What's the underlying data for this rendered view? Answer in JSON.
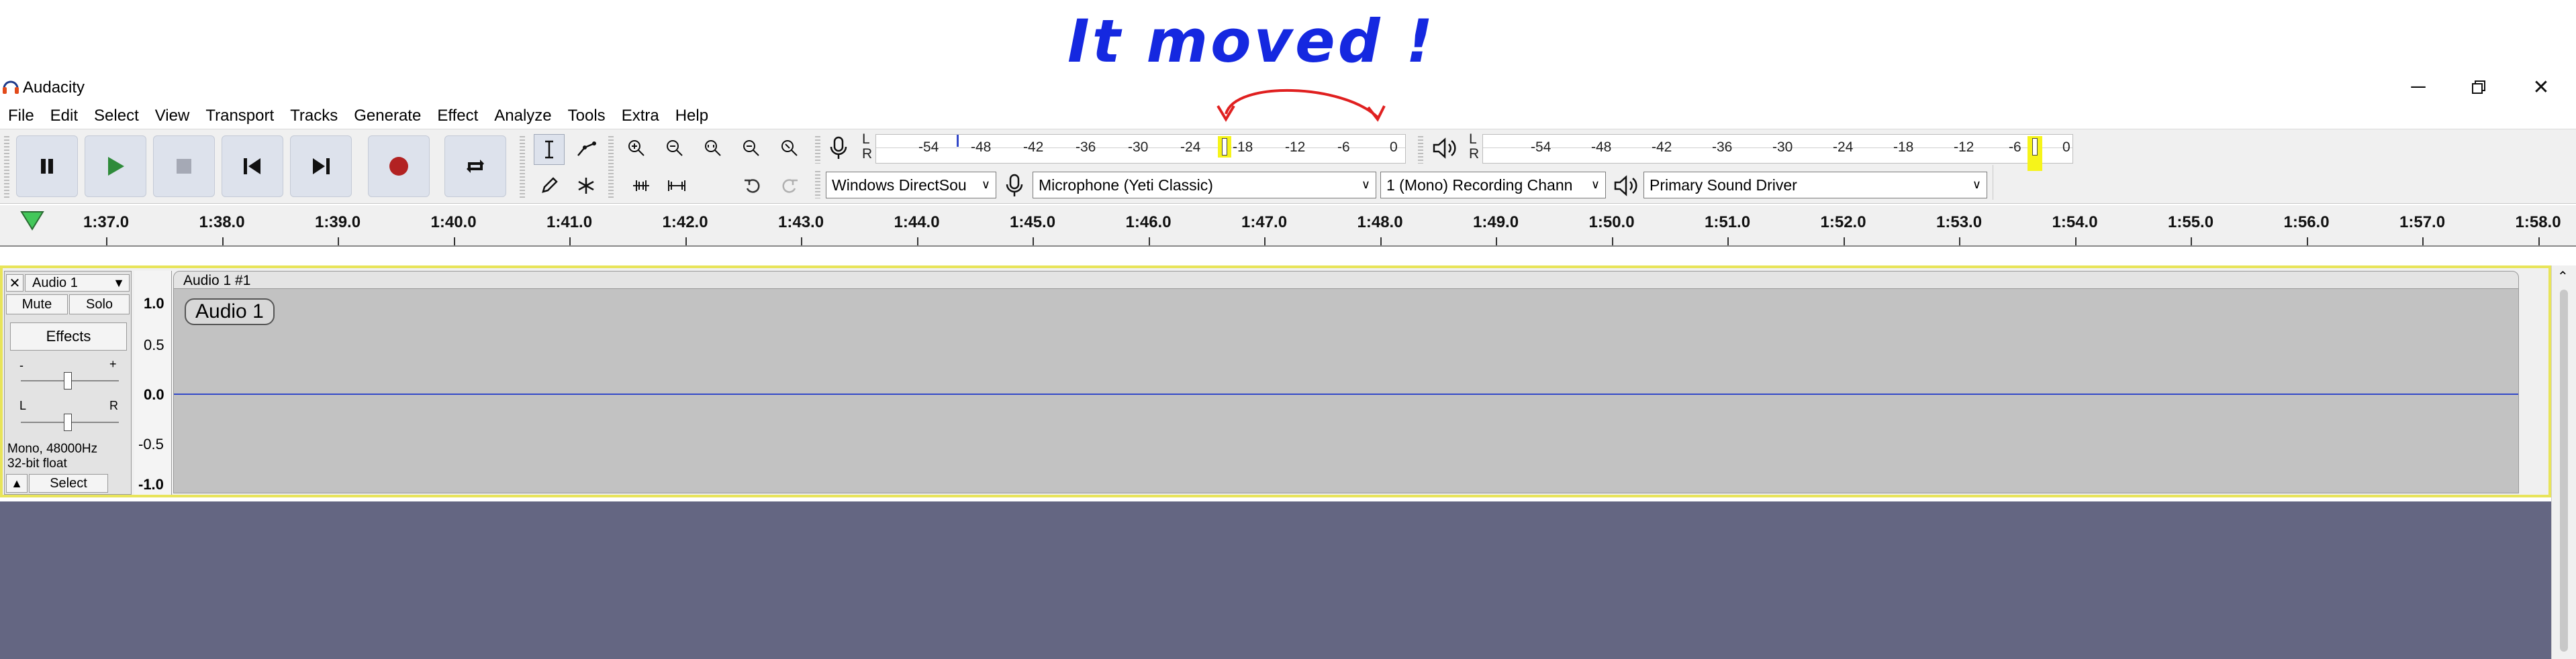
{
  "annotation": {
    "text": "It moved !",
    "arrow_color": "#e02020",
    "text_color": "#1528e0",
    "highlight_color": "#f6f41a"
  },
  "window": {
    "title": "Audacity",
    "minimize_icon": "minimize-icon",
    "restore_icon": "restore-icon",
    "close_icon": "close-icon"
  },
  "menu": [
    "File",
    "Edit",
    "Select",
    "View",
    "Transport",
    "Tracks",
    "Generate",
    "Effect",
    "Analyze",
    "Tools",
    "Extra",
    "Help"
  ],
  "transport": {
    "buttons": [
      "pause-icon",
      "play-icon",
      "stop-icon",
      "skip-start-icon",
      "skip-end-icon",
      "record-icon",
      "loop-icon"
    ]
  },
  "record_meter": {
    "lr_top": "L",
    "lr_bottom": "R",
    "ticks": [
      "-54",
      "-48",
      "-42",
      "-36",
      "-30",
      "-24",
      "-18",
      "-12",
      "-6",
      "0"
    ]
  },
  "playback_meter": {
    "lr_top": "L",
    "lr_bottom": "R",
    "ticks": [
      "-54",
      "-48",
      "-42",
      "-36",
      "-30",
      "-24",
      "-18",
      "-12",
      "-6",
      "0"
    ]
  },
  "device": {
    "host": "Windows DirectSou",
    "recording_device": "Microphone (Yeti Classic)",
    "channels": "1 (Mono) Recording Chann",
    "playback_device": "Primary Sound Driver"
  },
  "timeline": {
    "labels": [
      "1:37.0",
      "1:38.0",
      "1:39.0",
      "1:40.0",
      "1:41.0",
      "1:42.0",
      "1:43.0",
      "1:44.0",
      "1:45.0",
      "1:46.0",
      "1:47.0",
      "1:48.0",
      "1:49.0",
      "1:50.0",
      "1:51.0",
      "1:52.0",
      "1:53.0",
      "1:54.0",
      "1:55.0",
      "1:56.0",
      "1:57.0",
      "1:58.0"
    ]
  },
  "track": {
    "name": "Audio 1",
    "mute": "Mute",
    "solo": "Solo",
    "effects": "Effects",
    "gain_minus": "-",
    "gain_plus": "+",
    "pan_left": "L",
    "pan_right": "R",
    "format_line1": "Mono, 48000Hz",
    "format_line2": "32-bit float",
    "select": "Select",
    "clip_title": "Audio 1 #1",
    "clip_label": "Audio 1",
    "y_ticks": [
      "1.0",
      "0.5",
      "0.0",
      "-0.5",
      "-1.0"
    ]
  },
  "colors": {
    "waveform_bg": "#c2c2c2",
    "waveform_line": "#3348c8",
    "empty_area": "#646682",
    "track_selected_border": "#e8e45a",
    "record_red": "#b22222",
    "play_green": "#2e8b3a"
  }
}
